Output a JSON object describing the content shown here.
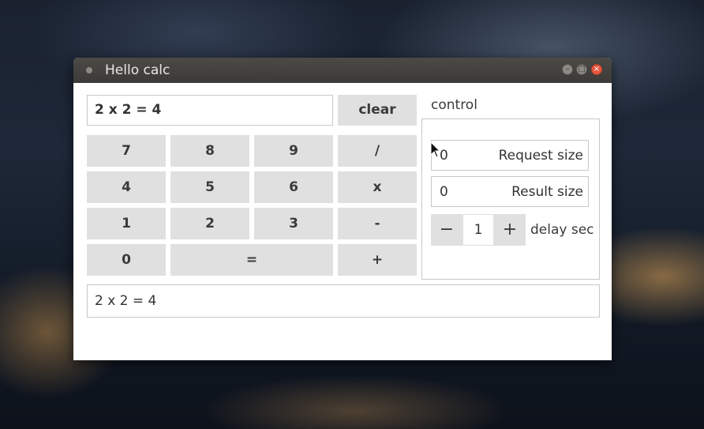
{
  "window": {
    "title": "Hello calc"
  },
  "calc": {
    "display_value": "2 x 2 = 4",
    "clear_label": "clear",
    "keys": {
      "k7": "7",
      "k8": "8",
      "k9": "9",
      "div": "/",
      "k4": "4",
      "k5": "5",
      "k6": "6",
      "mul": "x",
      "k1": "1",
      "k2": "2",
      "k3": "3",
      "sub": "-",
      "k0": "0",
      "eq": "=",
      "add": "+"
    },
    "result_line": "2 x 2 = 4"
  },
  "control": {
    "heading": "control",
    "request_size_value": "0",
    "request_size_label": "Request size",
    "result_size_value": "0",
    "result_size_label": "Result size",
    "delay_minus": "−",
    "delay_value": "1",
    "delay_plus": "+",
    "delay_label": "delay sec"
  }
}
